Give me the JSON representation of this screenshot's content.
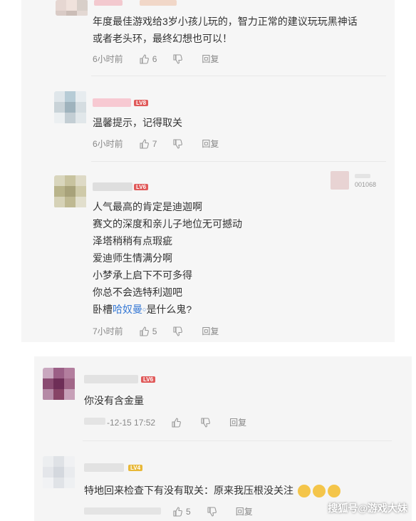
{
  "comments": [
    {
      "lines": [
        "年度最佳游戏给3岁小孩儿玩的，智力正常的建议玩玩黑神话",
        "或者老头环，最终幻想也可以！"
      ],
      "time": "6小时前",
      "likes": "6",
      "reply": "回复"
    },
    {
      "badge": "LV8",
      "lines": [
        "温馨提示，记得取关"
      ],
      "time": "6小时前",
      "likes": "7",
      "reply": "回复"
    },
    {
      "badge": "LV6",
      "corner_id": "001068",
      "lines": [
        "人气最高的肯定是迪迦啊",
        "赛文的深度和亲儿子地位无可撼动",
        "泽塔稍稍有点瑕疵",
        "爱迪师生情满分啊",
        "小梦承上启下不可多得",
        "你总不会选特利迦吧"
      ],
      "last_line": {
        "before": "卧槽",
        "link": "哈奴曼",
        "after": "是什么鬼?"
      },
      "time": "7小时前",
      "likes": "5",
      "reply": "回复"
    },
    {
      "badge": "LV6",
      "lines": [
        "你没有含金量"
      ],
      "time": "-12-15 17:52",
      "reply": "回复"
    },
    {
      "badge": "LV4",
      "lines": [
        "特地回来检查下有没有取关：原来我压根没关注"
      ],
      "likes": "5",
      "reply": "回复"
    }
  ],
  "watermark": "搜狐号@游戏大妹",
  "colors": {
    "badge_red": "#e05a5a",
    "badge_yellow": "#e8b838",
    "link": "#3a7bd5"
  }
}
